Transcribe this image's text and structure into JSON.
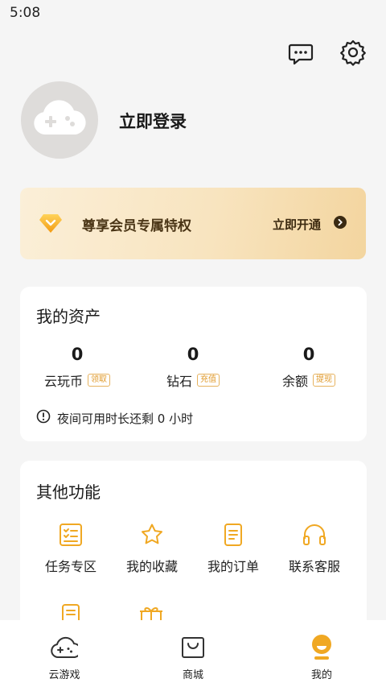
{
  "status_bar": {
    "time": "5:08"
  },
  "header": {
    "message_icon": "message-icon",
    "settings_icon": "gear-icon"
  },
  "profile": {
    "login_text": "立即登录",
    "avatar_icon": "gamepad-cloud-icon"
  },
  "vip": {
    "title": "尊享会员专属特权",
    "cta": "立即开通",
    "icon": "diamond-icon"
  },
  "assets": {
    "title": "我的资产",
    "items": [
      {
        "value": "0",
        "label": "云玩币",
        "tag": "领取"
      },
      {
        "value": "0",
        "label": "钻石",
        "tag": "充值"
      },
      {
        "value": "0",
        "label": "余额",
        "tag": "提现"
      }
    ],
    "night_notice": "夜间可用时长还剩 0 小时"
  },
  "features": {
    "title": "其他功能",
    "items": [
      {
        "label": "任务专区",
        "icon": "task-list-icon"
      },
      {
        "label": "我的收藏",
        "icon": "star-icon"
      },
      {
        "label": "我的订单",
        "icon": "order-icon"
      },
      {
        "label": "联系客服",
        "icon": "headphones-icon"
      }
    ]
  },
  "tabbar": {
    "items": [
      {
        "label": "云游戏",
        "icon": "gamepad-icon"
      },
      {
        "label": "商城",
        "icon": "shopping-bag-icon"
      },
      {
        "label": "我的",
        "icon": "profile-face-icon"
      }
    ]
  },
  "colors": {
    "accent": "#f0a823",
    "background": "#f5f5f5",
    "vip_text": "#4a3516"
  }
}
